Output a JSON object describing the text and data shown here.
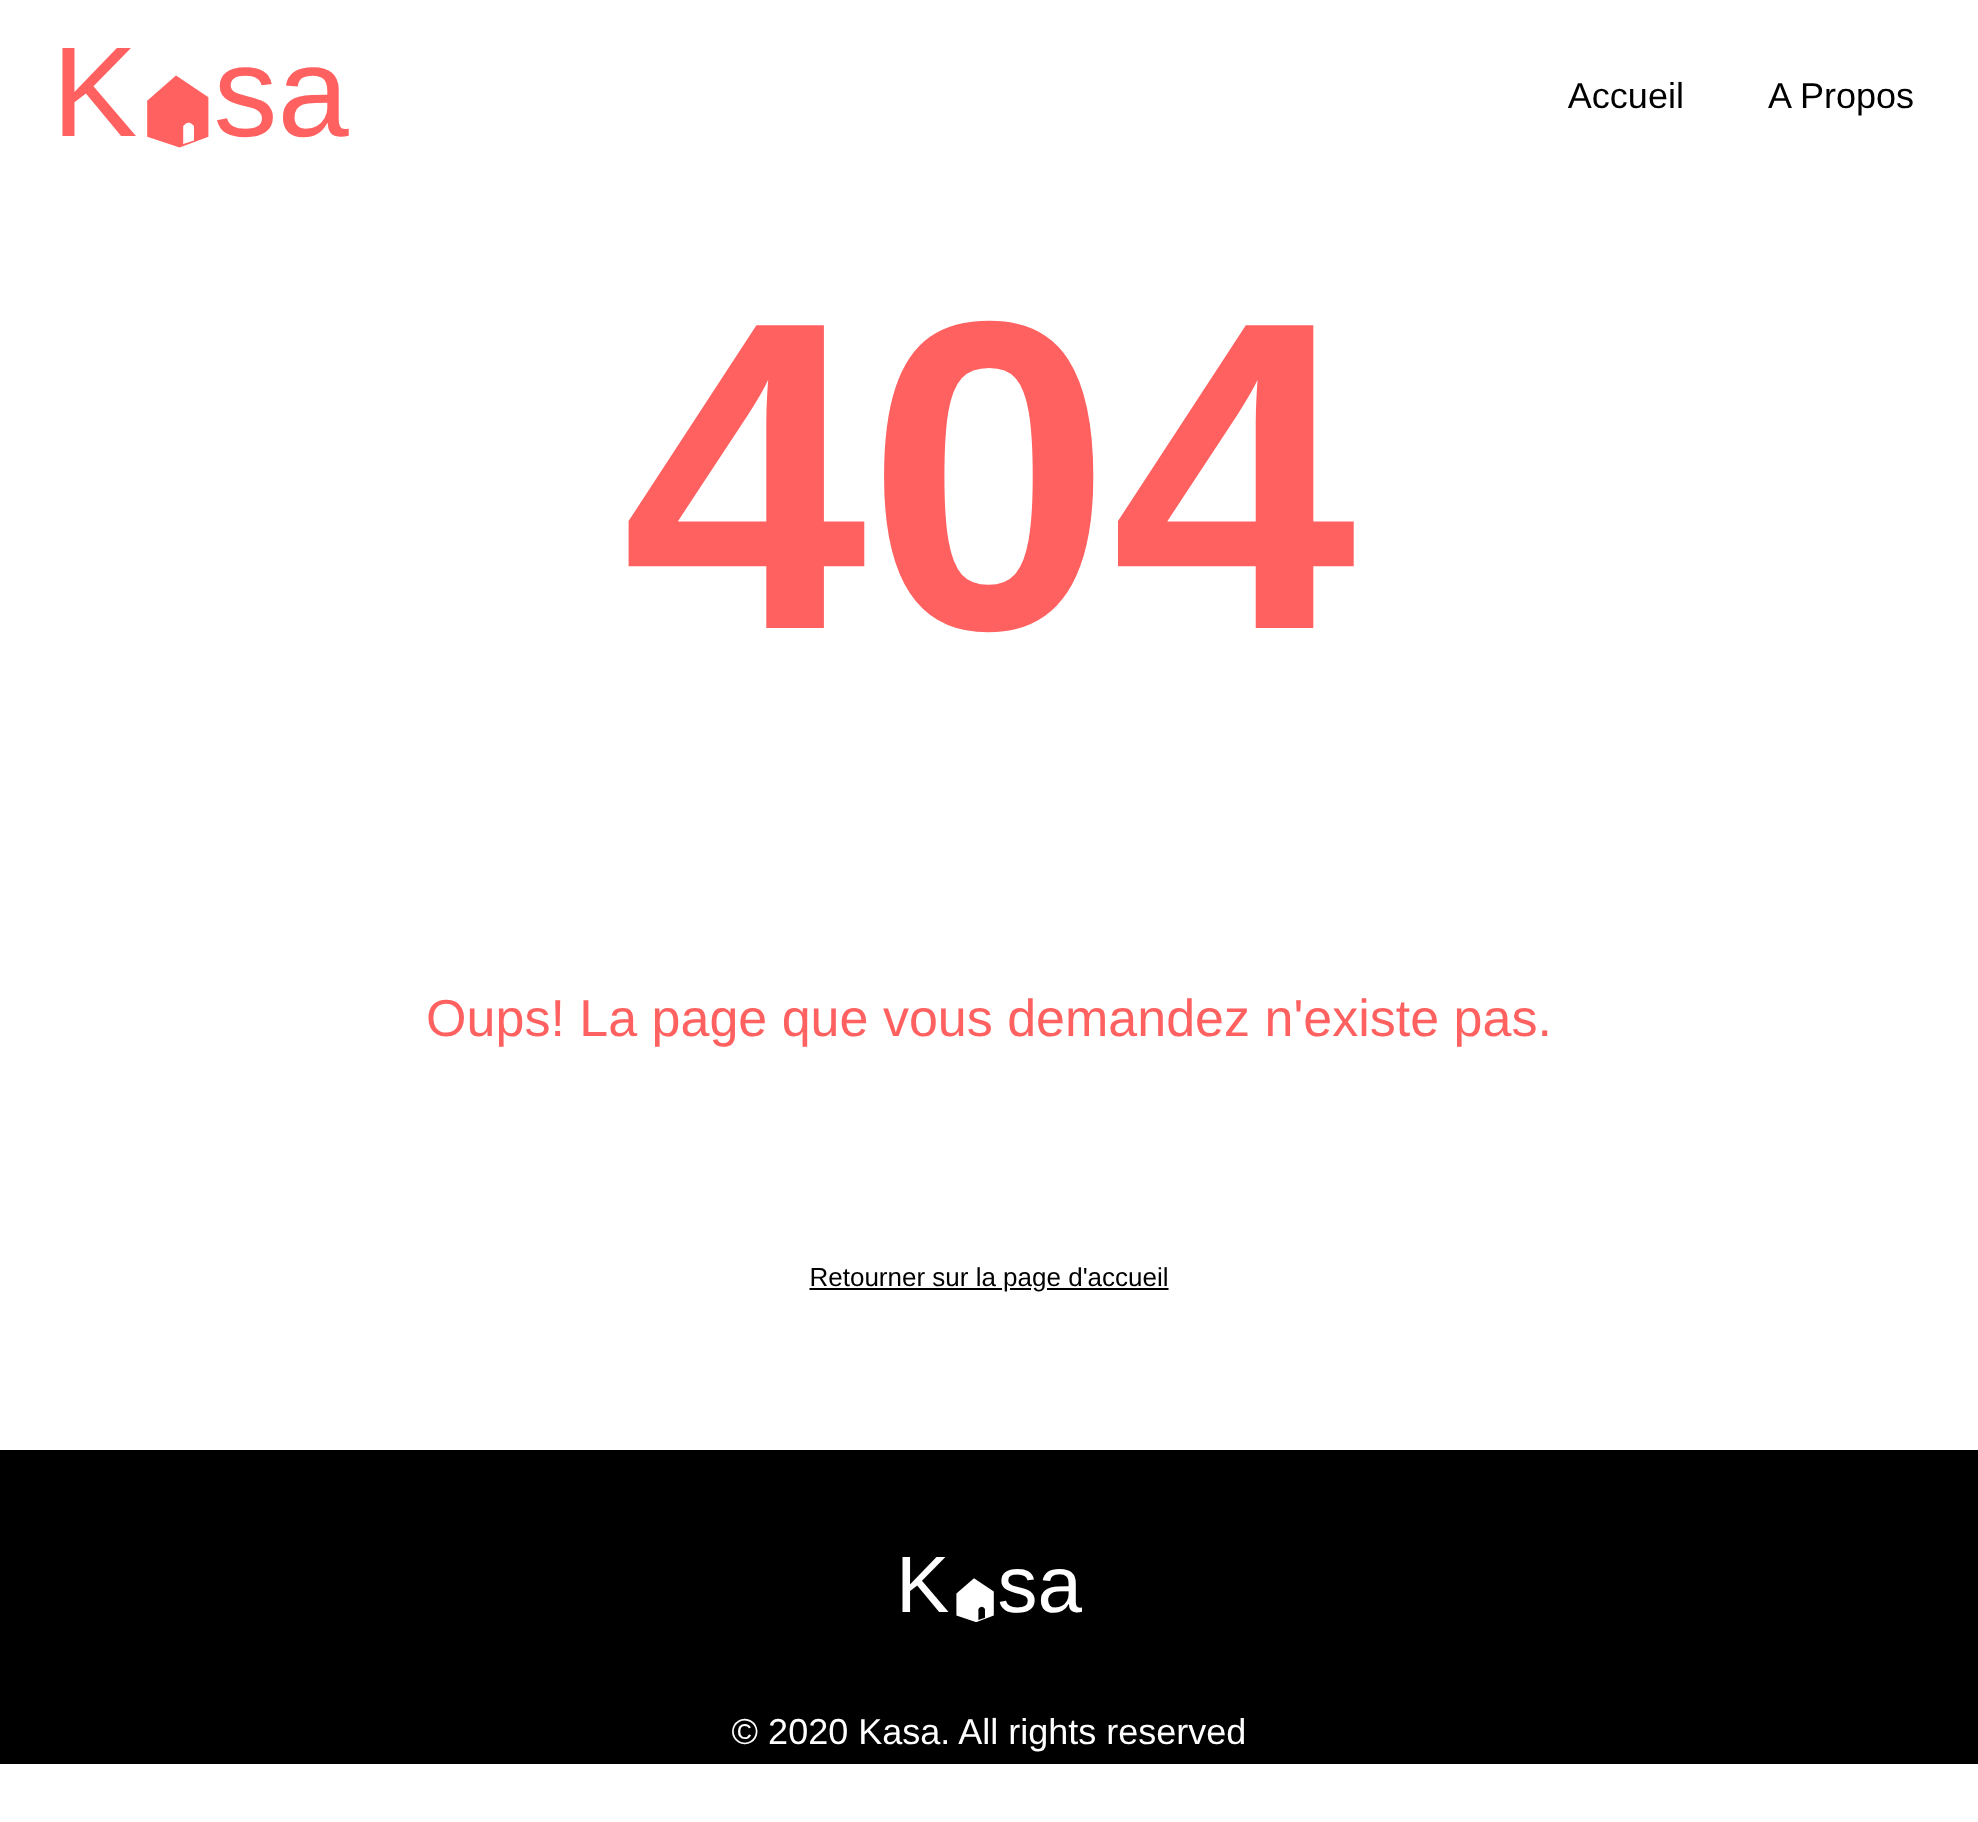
{
  "header": {
    "logo": {
      "lead": "K",
      "tail": "sa"
    },
    "nav": [
      {
        "label": "Accueil"
      },
      {
        "label": "A Propos"
      }
    ]
  },
  "error": {
    "code": "404",
    "message": "Oups! La page que vous demandez n'existe pas.",
    "link": "Retourner sur la page d'accueil"
  },
  "footer": {
    "logo": {
      "lead": "K",
      "tail": "sa"
    },
    "copyright": "© 2020 Kasa. All rights reserved"
  }
}
